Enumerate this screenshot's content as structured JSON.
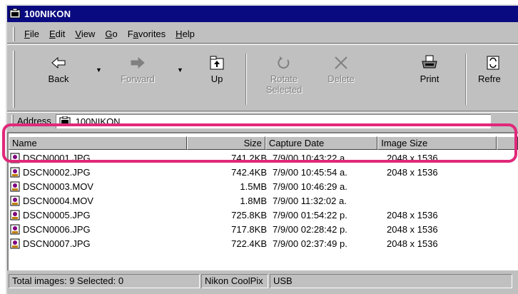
{
  "window": {
    "title": "100NIKON"
  },
  "menu": {
    "items": [
      {
        "pre": "",
        "ul": "F",
        "post": "ile"
      },
      {
        "pre": "",
        "ul": "E",
        "post": "dit"
      },
      {
        "pre": "",
        "ul": "V",
        "post": "iew"
      },
      {
        "pre": "",
        "ul": "G",
        "post": "o"
      },
      {
        "pre": "F",
        "ul": "a",
        "post": "vorites"
      },
      {
        "pre": "",
        "ul": "H",
        "post": "elp"
      }
    ]
  },
  "toolbar": {
    "back": "Back",
    "forward": "Forward",
    "up": "Up",
    "rotate_line1": "Rotate",
    "rotate_line2": "Selected",
    "delete": "Delete",
    "print": "Print",
    "refresh": "Refre"
  },
  "address": {
    "label": "Address",
    "value": "100NIKON"
  },
  "list": {
    "columns": [
      "Name",
      "Size",
      "Capture Date",
      "Image Size"
    ],
    "rows": [
      {
        "name": "DSCN0001.JPG",
        "size": "741.2KB",
        "date": "7/9/00 10:43:22 a.",
        "image_size": "2048 x 1536"
      },
      {
        "name": "DSCN0002.JPG",
        "size": "742.4KB",
        "date": "7/9/00 10:45:54 a.",
        "image_size": "2048 x 1536"
      },
      {
        "name": "DSCN0003.MOV",
        "size": "1.5MB",
        "date": "7/9/00 10:46:29 a.",
        "image_size": ""
      },
      {
        "name": "DSCN0004.MOV",
        "size": "1.8MB",
        "date": "7/9/00 11:32:02 a.",
        "image_size": ""
      },
      {
        "name": "DSCN0005.JPG",
        "size": "725.8KB",
        "date": "7/9/00 01:54:22 p.",
        "image_size": "2048 x 1536"
      },
      {
        "name": "DSCN0006.JPG",
        "size": "717.8KB",
        "date": "7/9/00 02:28:42 p.",
        "image_size": "2048 x 1536"
      },
      {
        "name": "DSCN0007.JPG",
        "size": "722.4KB",
        "date": "7/9/00 02:37:49 p.",
        "image_size": "2048 x 1536"
      }
    ]
  },
  "status": {
    "images": "Total images: 9   Selected: 0",
    "camera": "Nikon CoolPix",
    "port": "USB"
  },
  "colors": {
    "title_bar": "#0a0a80",
    "highlight": "#e0287a",
    "chrome": "#c0c0c0"
  }
}
